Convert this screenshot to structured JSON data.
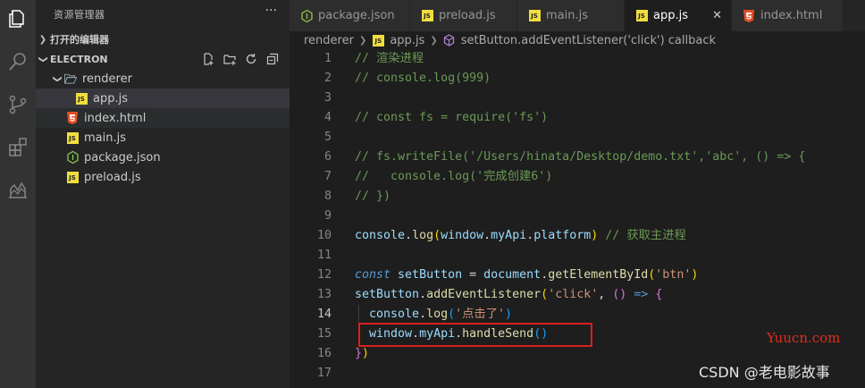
{
  "sidebar": {
    "title": "资源管理器",
    "more": "···",
    "open_editors": "打开的编辑器",
    "workspace": "ELECTRON",
    "tree": [
      {
        "label": "renderer",
        "icon": "folder-open-icon",
        "depth": 1
      },
      {
        "label": "app.js",
        "icon": "js-icon",
        "depth": 2
      },
      {
        "label": "index.html",
        "icon": "html5-icon",
        "depth": 1
      },
      {
        "label": "main.js",
        "icon": "js-icon",
        "depth": 1
      },
      {
        "label": "package.json",
        "icon": "nodejs-icon",
        "depth": 1
      },
      {
        "label": "preload.js",
        "icon": "js-icon",
        "depth": 1
      }
    ]
  },
  "tabs": [
    {
      "label": "package.json",
      "icon": "nodejs-icon",
      "active": false
    },
    {
      "label": "preload.js",
      "icon": "js-icon",
      "active": false
    },
    {
      "label": "main.js",
      "icon": "js-icon",
      "active": false
    },
    {
      "label": "app.js",
      "icon": "js-icon",
      "active": true,
      "close": "✕"
    },
    {
      "label": "index.html",
      "icon": "html5-icon",
      "active": false
    }
  ],
  "breadcrumb": {
    "folder": "renderer",
    "file": "app.js",
    "symbol": "setButton.addEventListener('click') callback"
  },
  "editor": {
    "lines": [
      {
        "n": "1",
        "tokens": [
          [
            "comment",
            "// 渲染进程"
          ]
        ]
      },
      {
        "n": "2",
        "tokens": [
          [
            "comment",
            "// console.log(999)"
          ]
        ]
      },
      {
        "n": "3",
        "tokens": []
      },
      {
        "n": "4",
        "tokens": [
          [
            "comment",
            "// const fs = require('fs')"
          ]
        ]
      },
      {
        "n": "5",
        "tokens": []
      },
      {
        "n": "6",
        "tokens": [
          [
            "comment",
            "// fs.writeFile('/Users/hinata/Desktop/demo.txt','abc', () => {"
          ]
        ]
      },
      {
        "n": "7",
        "tokens": [
          [
            "comment",
            "//   console.log('完成创建6')"
          ]
        ]
      },
      {
        "n": "8",
        "tokens": [
          [
            "comment",
            "// })"
          ]
        ]
      },
      {
        "n": "9",
        "tokens": []
      },
      {
        "n": "10",
        "tokens": [
          [
            "var",
            "console"
          ],
          [
            "plain",
            "."
          ],
          [
            "fn",
            "log"
          ],
          [
            "br-y",
            "("
          ],
          [
            "var",
            "window"
          ],
          [
            "plain",
            "."
          ],
          [
            "var",
            "myApi"
          ],
          [
            "plain",
            "."
          ],
          [
            "var",
            "platform"
          ],
          [
            "br-y",
            ")"
          ],
          [
            "plain",
            " "
          ],
          [
            "comment",
            "// 获取主进程"
          ]
        ]
      },
      {
        "n": "11",
        "tokens": []
      },
      {
        "n": "12",
        "tokens": [
          [
            "kw",
            "const"
          ],
          [
            "plain",
            " "
          ],
          [
            "var",
            "setButton"
          ],
          [
            "op",
            " = "
          ],
          [
            "var",
            "document"
          ],
          [
            "plain",
            "."
          ],
          [
            "fn",
            "getElementById"
          ],
          [
            "br-y",
            "("
          ],
          [
            "str",
            "'btn'"
          ],
          [
            "br-y",
            ")"
          ]
        ]
      },
      {
        "n": "13",
        "tokens": [
          [
            "var",
            "setButton"
          ],
          [
            "plain",
            "."
          ],
          [
            "fn",
            "addEventListener"
          ],
          [
            "br-y",
            "("
          ],
          [
            "str",
            "'click'"
          ],
          [
            "plain",
            ", "
          ],
          [
            "br",
            "()"
          ],
          [
            "plain",
            " "
          ],
          [
            "kw",
            "=>"
          ],
          [
            "plain",
            " "
          ],
          [
            "br",
            "{"
          ]
        ]
      },
      {
        "n": "14",
        "tokens": [
          [
            "plain",
            "  "
          ],
          [
            "var",
            "console"
          ],
          [
            "plain",
            "."
          ],
          [
            "fn",
            "log"
          ],
          [
            "br2",
            "("
          ],
          [
            "str",
            "'点击了'"
          ],
          [
            "br2",
            ")"
          ]
        ]
      },
      {
        "n": "15",
        "tokens": [
          [
            "plain",
            "  "
          ],
          [
            "var",
            "window"
          ],
          [
            "plain",
            "."
          ],
          [
            "var",
            "myApi"
          ],
          [
            "plain",
            "."
          ],
          [
            "fn",
            "handleSend"
          ],
          [
            "br2",
            "()"
          ]
        ]
      },
      {
        "n": "16",
        "tokens": [
          [
            "br",
            "}"
          ],
          [
            "br-y",
            ")"
          ]
        ]
      },
      {
        "n": "17",
        "tokens": []
      }
    ],
    "current_line": "14"
  },
  "watermarks": {
    "site": "Yuucn.com",
    "author": "CSDN @老电影故事"
  },
  "colors": {
    "activity_bar": "#333333",
    "sidebar": "#252526",
    "editor": "#1e1e1e",
    "highlight_box": "#d9201f",
    "js_badge": "#f1dd3f"
  }
}
